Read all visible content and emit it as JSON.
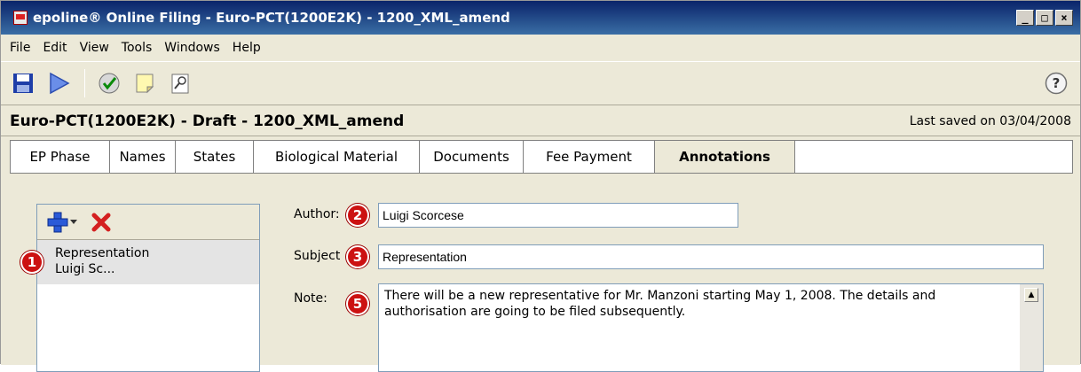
{
  "window": {
    "title": "epoline® Online Filing - Euro-PCT(1200E2K) - 1200_XML_amend",
    "controls": [
      "_",
      "□",
      "×"
    ]
  },
  "menu": [
    "File",
    "Edit",
    "View",
    "Tools",
    "Windows",
    "Help"
  ],
  "toolbar": {
    "icons": [
      "save-icon",
      "run-icon",
      "check-icon",
      "note-icon",
      "search-document-icon"
    ],
    "help_icon": "help-icon",
    "help_label": "?"
  },
  "docbar": {
    "title": "Euro-PCT(1200E2K) - Draft - 1200_XML_amend",
    "saved": "Last saved on 03/04/2008"
  },
  "tabs": [
    {
      "label": "EP Phase",
      "active": false
    },
    {
      "label": "Names",
      "active": false
    },
    {
      "label": "States",
      "active": false
    },
    {
      "label": "Biological Material",
      "active": false
    },
    {
      "label": "Documents",
      "active": false
    },
    {
      "label": "Fee Payment",
      "active": false
    },
    {
      "label": "Annotations",
      "active": true
    }
  ],
  "annotations": {
    "list": [
      {
        "title": "Representation",
        "author": "Luigi Sc..."
      }
    ],
    "form": {
      "author_label": "Author:",
      "author_value": "Luigi Scorcese",
      "subject_label": "Subject",
      "subject_value": "Representation",
      "note_label": "Note:",
      "note_value": "There will be a new representative for Mr. Manzoni starting May 1, 2008. The details and authorisation are going to be filed subsequently."
    }
  },
  "badges": [
    "1",
    "2",
    "3",
    "5"
  ],
  "colors": {
    "title_bar": "#0a246a",
    "badge": "#cc1111",
    "tab_active": "#ece9d8"
  }
}
